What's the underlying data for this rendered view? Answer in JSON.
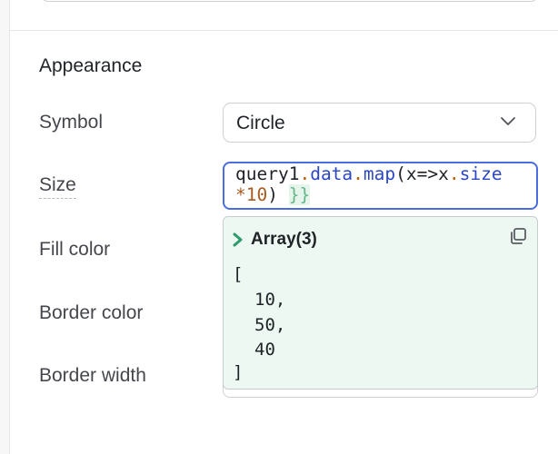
{
  "section": {
    "title": "Appearance"
  },
  "fields": {
    "symbol": {
      "label": "Symbol",
      "value": "Circle"
    },
    "size": {
      "label": "Size",
      "code_line1": {
        "ident": "query1",
        "dot1": ".",
        "prop1": "data",
        "dot2": ".",
        "prop2": "map",
        "open": "(x=>x",
        "dot3": ".",
        "prop3": "size"
      },
      "code_line2": {
        "star": "*",
        "num": "10",
        "close": ") ",
        "brace": "}}"
      }
    },
    "fill_color": {
      "label": "Fill color"
    },
    "border_color": {
      "label": "Border color"
    },
    "border_width": {
      "label": "Border width"
    }
  },
  "preview": {
    "title": "Array(3)",
    "open_bracket": "[",
    "items": [
      "10,",
      "50,",
      "40"
    ],
    "close_bracket": "]"
  },
  "icons": {
    "chevron": "chevron-down-icon",
    "expand": "chevron-right-icon",
    "copy": "copy-icon"
  },
  "colors": {
    "accent_border": "#4a6ee0",
    "preview_bg": "#eef8f2",
    "expand_icon": "#2e9a6b"
  }
}
